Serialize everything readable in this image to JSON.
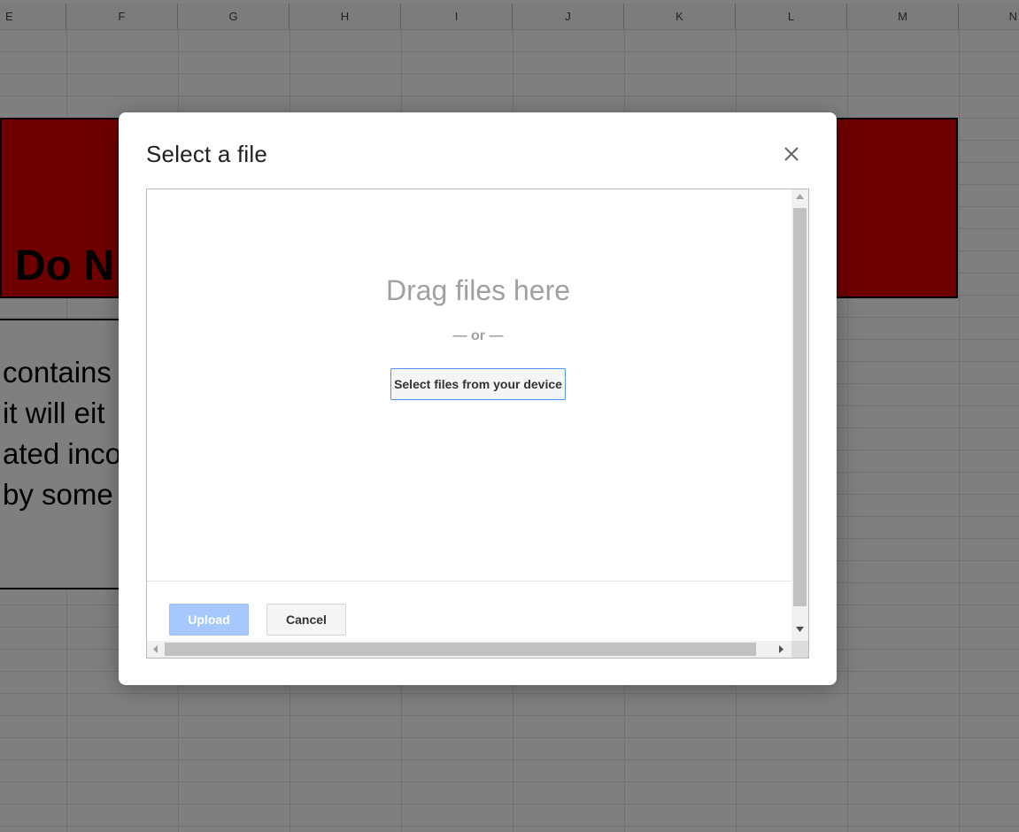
{
  "spreadsheet": {
    "column_headers": [
      "E",
      "F",
      "G",
      "H",
      "I",
      "J",
      "K",
      "L",
      "M",
      "N"
    ],
    "warning_title_partial": "Do N",
    "warning_body_partial": [
      "contains",
      "it will eit",
      "ated inco",
      "by some"
    ],
    "colors": {
      "banner_red": "#dd0000"
    }
  },
  "dialog": {
    "title": "Select a file",
    "close_icon": "close-icon",
    "drop_zone": {
      "heading": "Drag files here",
      "separator": "— or —",
      "select_button_label": "Select files from your device"
    },
    "footer": {
      "upload_label": "Upload",
      "upload_enabled": false,
      "cancel_label": "Cancel"
    }
  },
  "colors": {
    "upload_disabled_bg": "#a6c8ff",
    "select_button_border": "#4d90fe"
  }
}
